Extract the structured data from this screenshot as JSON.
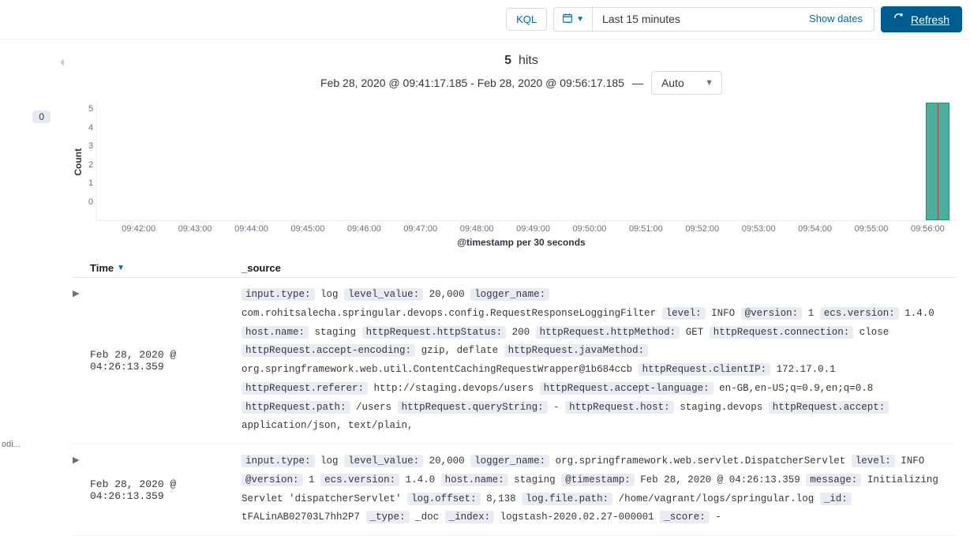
{
  "topbar": {
    "kql_label": "KQL",
    "range_text": "Last 15 minutes",
    "show_dates": "Show dates",
    "refresh": "Refresh"
  },
  "left": {
    "badge": "0",
    "bottom_text": "odi..."
  },
  "hits": {
    "count": "5",
    "label": "hits",
    "range": "Feb 28, 2020 @ 09:41:17.185 - Feb 28, 2020 @ 09:56:17.185",
    "dash": "—",
    "interval": "Auto"
  },
  "chart_data": {
    "type": "bar",
    "ylabel": "Count",
    "xlabel": "@timestamp per 30 seconds",
    "ylim": [
      0,
      5
    ],
    "yticks": [
      "5",
      "4",
      "3",
      "2",
      "1",
      "0"
    ],
    "xticks": [
      "09:42:00",
      "09:43:00",
      "09:44:00",
      "09:45:00",
      "09:46:00",
      "09:47:00",
      "09:48:00",
      "09:49:00",
      "09:50:00",
      "09:51:00",
      "09:52:00",
      "09:53:00",
      "09:54:00",
      "09:55:00",
      "09:56:00"
    ],
    "categories": [
      "09:56:00"
    ],
    "values": [
      5
    ]
  },
  "table": {
    "headers": {
      "time": "Time",
      "source": "_source"
    },
    "rows": [
      {
        "time": "Feb 28, 2020 @ 04:26:13.359",
        "fields": [
          {
            "k": "input.type:",
            "v": "log"
          },
          {
            "k": "level_value:",
            "v": "20,000"
          },
          {
            "k": "logger_name:",
            "v": "com.rohitsalecha.springular.devops.config.RequestResponseLoggingFilter"
          },
          {
            "k": "level:",
            "v": "INFO"
          },
          {
            "k": "@version:",
            "v": "1"
          },
          {
            "k": "ecs.version:",
            "v": "1.4.0"
          },
          {
            "k": "host.name:",
            "v": "staging"
          },
          {
            "k": "httpRequest.httpStatus:",
            "v": "200"
          },
          {
            "k": "httpRequest.httpMethod:",
            "v": "GET"
          },
          {
            "k": "httpRequest.connection:",
            "v": "close"
          },
          {
            "k": "httpRequest.accept-encoding:",
            "v": "gzip, deflate"
          },
          {
            "k": "httpRequest.javaMethod:",
            "v": "org.springframework.web.util.ContentCachingRequestWrapper@1b684ccb"
          },
          {
            "k": "httpRequest.clientIP:",
            "v": "172.17.0.1"
          },
          {
            "k": "httpRequest.referer:",
            "v": "http://staging.devops/users"
          },
          {
            "k": "httpRequest.accept-language:",
            "v": "en-GB,en-US;q=0.9,en;q=0.8"
          },
          {
            "k": "httpRequest.path:",
            "v": "/users"
          },
          {
            "k": "httpRequest.queryString:",
            "v": "-"
          },
          {
            "k": "httpRequest.host:",
            "v": "staging.devops"
          },
          {
            "k": "httpRequest.accept:",
            "v": "application/json, text/plain,"
          }
        ]
      },
      {
        "time": "Feb 28, 2020 @ 04:26:13.359",
        "fields": [
          {
            "k": "input.type:",
            "v": "log"
          },
          {
            "k": "level_value:",
            "v": "20,000"
          },
          {
            "k": "logger_name:",
            "v": "org.springframework.web.servlet.DispatcherServlet"
          },
          {
            "k": "level:",
            "v": "INFO"
          },
          {
            "k": "@version:",
            "v": "1"
          },
          {
            "k": "ecs.version:",
            "v": "1.4.0"
          },
          {
            "k": "host.name:",
            "v": "staging"
          },
          {
            "k": "@timestamp:",
            "v": "Feb 28, 2020 @ 04:26:13.359"
          },
          {
            "k": "message:",
            "v": "Initializing Servlet 'dispatcherServlet'"
          },
          {
            "k": "log.offset:",
            "v": "8,138"
          },
          {
            "k": "log.file.path:",
            "v": "/home/vagrant/logs/springular.log"
          },
          {
            "k": "_id:",
            "v": "tFALinAB02703L7hh2P7"
          },
          {
            "k": "_type:",
            "v": "_doc"
          },
          {
            "k": "_index:",
            "v": "logstash-2020.02.27-000001"
          },
          {
            "k": "_score:",
            "v": "-"
          }
        ]
      }
    ]
  }
}
